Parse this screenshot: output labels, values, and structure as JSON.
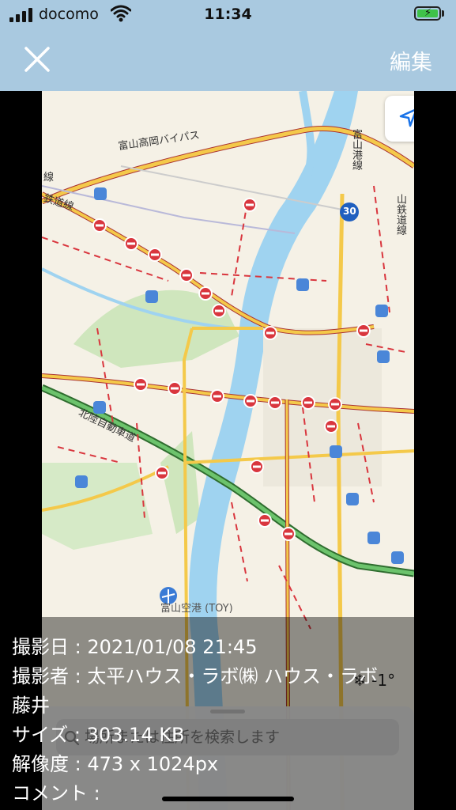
{
  "status_bar": {
    "carrier": "docomo",
    "time": "11:34",
    "battery_state": "charging",
    "battery_color": "#3fc24a"
  },
  "nav": {
    "close_icon": "close-icon",
    "edit_label": "編集",
    "background": "#a9c9e0"
  },
  "map": {
    "labels": {
      "bypass": "富山高岡バイパス",
      "port_line": "富山港線",
      "route_shield": "30",
      "tetsudo_left": "鉄道線",
      "sen_left": "線",
      "tetsudo_right": "山鉄道線",
      "expressway": "北陸自動車道",
      "airport": "富山空港 (TOY)"
    },
    "colors": {
      "land": "#f5f1e6",
      "water": "#9fd3f0",
      "park": "#c8e6b0",
      "highway": "#f4c94a",
      "expressway": "#5cb85c",
      "closure": "#d9363e"
    }
  },
  "weather": {
    "icon": "snowflake-icon",
    "temperature": "-1°"
  },
  "search": {
    "placeholder": "場所または住所を検索します"
  },
  "photo_info": {
    "date": "撮影日 : 2021/01/08 21:45",
    "author": "撮影者 : 太平ハウス・ラボ㈱ ハウス・ラボ",
    "author_cont": "藤井",
    "size": "サイズ : 303.14 KB",
    "resolution": "解像度 : 473 x 1024px",
    "comment": "コメント :"
  }
}
